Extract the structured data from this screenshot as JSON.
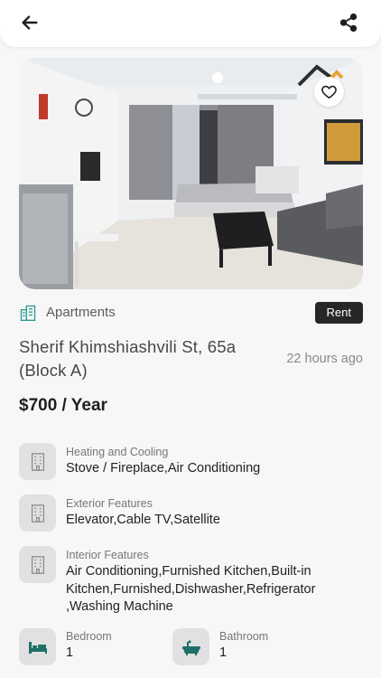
{
  "header": {
    "back_icon": "arrow-left-icon",
    "share_icon": "share-icon"
  },
  "listing": {
    "favorite_icon": "heart-outline-icon",
    "category": "Apartments",
    "category_icon": "building-icon",
    "badge": "Rent",
    "address": "Sherif Khimshiashvili St, 65a (Block A)",
    "posted": "22 hours ago",
    "price": "$700 / Year"
  },
  "features": [
    {
      "title": "Heating and Cooling",
      "value": "Stove / Fireplace,Air Conditioning",
      "icon": "building-icon"
    },
    {
      "title": "Exterior Features",
      "value": "Elevator,Cable TV,Satellite",
      "icon": "building-icon"
    },
    {
      "title": "Interior Features",
      "value": "Air Conditioning,Furnished Kitchen,Built-in Kitchen,Furnished,Dishwasher,Refrigerator ,Washing Machine",
      "icon": "building-icon"
    }
  ],
  "specs": {
    "bedroom": {
      "title": "Bedroom",
      "value": "1",
      "icon": "bed-icon"
    },
    "bathroom": {
      "title": "Bathroom",
      "value": "1",
      "icon": "bathtub-icon"
    }
  },
  "colors": {
    "accent": "#2a9d8f",
    "badge_bg": "#262626",
    "page_bg": "#f7f7f8"
  }
}
